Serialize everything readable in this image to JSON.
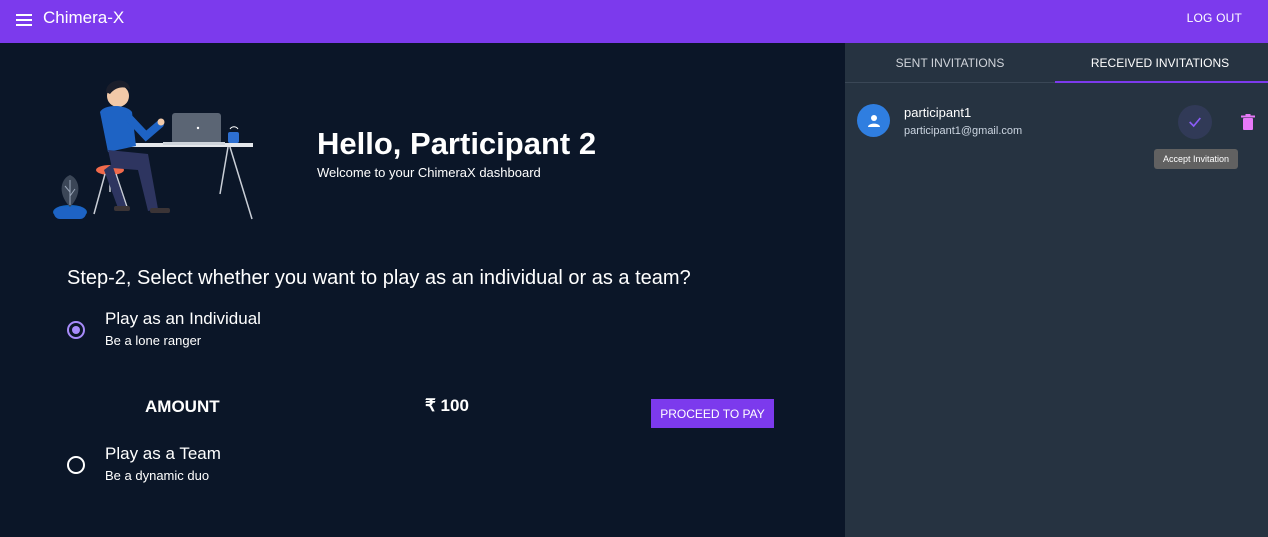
{
  "app": {
    "title": "Chimera-X",
    "logout_label": "LOG OUT"
  },
  "hero": {
    "title": "Hello, Participant 2",
    "subtitle": "Welcome to your ChimeraX dashboard"
  },
  "step": {
    "question": "Step-2, Select whether you want to play as an individual or as a team?",
    "options": [
      {
        "label": "Play as an Individual",
        "sub": "Be a lone ranger",
        "selected": true
      },
      {
        "label": "Play as a Team",
        "sub": "Be a dynamic duo",
        "selected": false
      }
    ]
  },
  "payment": {
    "amount_label": "AMOUNT",
    "amount_value": "₹ 100",
    "proceed_label": "PROCEED TO PAY"
  },
  "sidebar": {
    "tabs": [
      {
        "label": "SENT INVITATIONS",
        "active": false
      },
      {
        "label": "RECEIVED INVITATIONS",
        "active": true
      }
    ],
    "invitations": [
      {
        "name": "participant1",
        "email": "participant1@gmail.com"
      }
    ],
    "tooltip": "Accept Invitation"
  },
  "colors": {
    "accent": "#7c3aed",
    "background": "#0b1628",
    "sidebar": "#263341",
    "avatar": "#2f7ee0",
    "delete": "#e879f9"
  },
  "icons": [
    "menu-icon",
    "user-icon",
    "check-icon",
    "trash-icon"
  ]
}
